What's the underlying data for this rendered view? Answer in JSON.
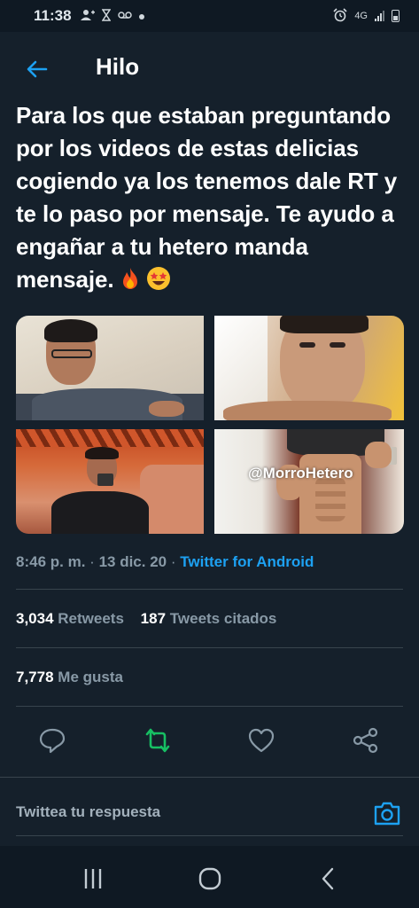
{
  "status_bar": {
    "time": "11:38",
    "network": "4G"
  },
  "header": {
    "title": "Hilo"
  },
  "tweet": {
    "text": "Para los que estaban preguntando por los videos de estas delicias cogiendo ya los tenemos dale RT y te lo paso por mensaje. Te ayudo a engañar a tu hetero manda mensaje.",
    "emojis": [
      "fire-emoji",
      "star-struck-emoji"
    ],
    "media_watermark": "@MorroHetero",
    "time": "8:46 p. m.",
    "separator": "·",
    "date": "13 dic. 20",
    "source": "Twitter for Android"
  },
  "stats": {
    "retweets_count": "3,034",
    "retweets_label": "Retweets",
    "quotes_count": "187",
    "quotes_label": "Tweets citados",
    "likes_count": "7,778",
    "likes_label": "Me gusta"
  },
  "reply": {
    "placeholder": "Twittea tu respuesta"
  },
  "colors": {
    "background": "#15202b",
    "accent": "#1da1f2",
    "retweet_active": "#17bf63",
    "secondary_text": "#8899a6",
    "divider": "#38444d"
  }
}
